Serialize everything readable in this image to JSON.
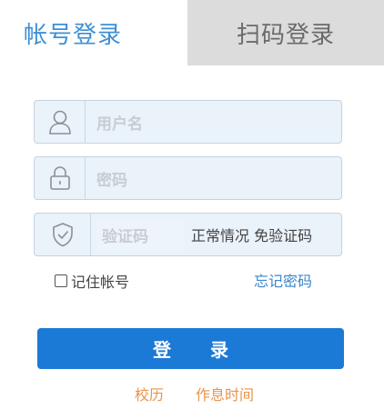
{
  "tabs": {
    "account": "帐号登录",
    "qrcode": "扫码登录"
  },
  "form": {
    "username_placeholder": "用户名",
    "password_placeholder": "密码",
    "captcha_placeholder": "验证码",
    "captcha_note": "正常情况 免验证码"
  },
  "options": {
    "remember_label": "记住帐号",
    "forgot_label": "忘记密码"
  },
  "login_button": "登 录",
  "links": {
    "calendar": "校历",
    "schedule": "作息时间"
  },
  "colors": {
    "primary": "#1b7ad6",
    "tab_active_text": "#3e8fd6",
    "link_orange": "#e8944a",
    "field_bg": "#eaf2fa"
  },
  "icons": {
    "username": "user-icon",
    "password": "lock-icon",
    "captcha": "shield-check-icon"
  }
}
